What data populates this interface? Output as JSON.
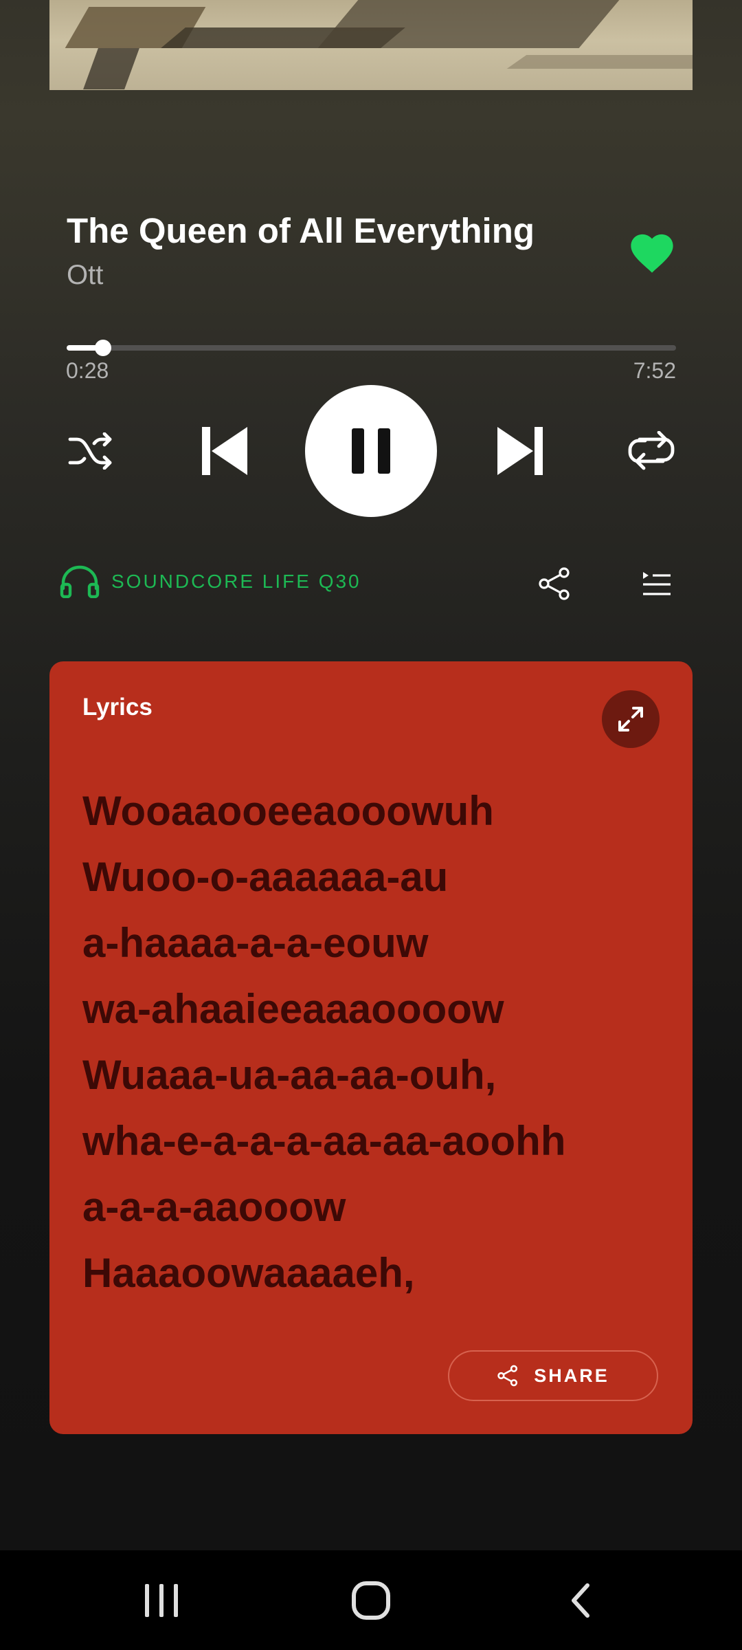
{
  "track": {
    "title": "The Queen of All Everything",
    "artist": "Ott",
    "liked": true
  },
  "playback": {
    "elapsed": "0:28",
    "total": "7:52",
    "progress_fraction": 0.06,
    "state": "playing"
  },
  "device": {
    "label": "SOUNDCORE LIFE Q30",
    "icon": "headphones-icon",
    "color": "#1db954"
  },
  "lyrics": {
    "heading": "Lyrics",
    "lines": [
      "Wooaaooeeaooowuh",
      "Wuoo-o-aaaaaa-au",
      "a-haaaa-a-a-eouw",
      "wa-ahaaieeaaaoooow",
      "Wuaaa-ua-aa-aa-ouh,",
      "wha-e-a-a-a-aa-aa-aoohh",
      "a-a-a-aaooow",
      "Haaaoowaaaaeh,"
    ],
    "share_label": "SHARE",
    "card_color": "#b72e1c"
  },
  "colors": {
    "accent": "#1db954",
    "text_secondary": "#b3b3b3"
  }
}
